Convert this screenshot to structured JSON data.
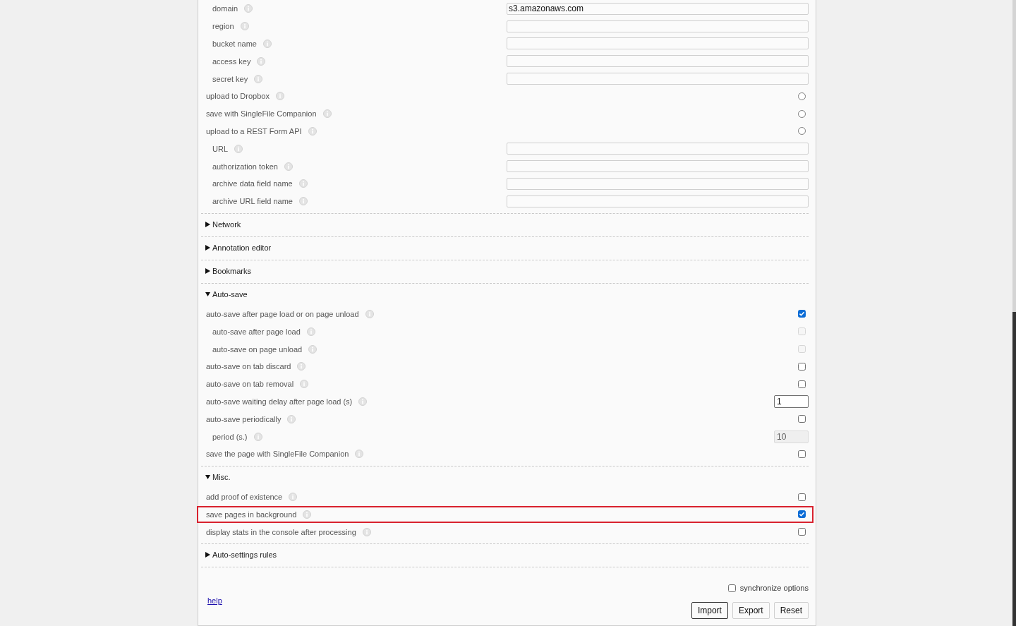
{
  "destination": {
    "sub_options": [
      {
        "label": "domain",
        "kind": "text",
        "value": "s3.amazonaws.com",
        "disabled": false
      },
      {
        "label": "region",
        "kind": "text",
        "disabled": false
      },
      {
        "label": "bucket name",
        "kind": "text",
        "disabled": false
      },
      {
        "label": "access key",
        "kind": "text",
        "disabled": false
      },
      {
        "label": "secret key",
        "kind": "text",
        "disabled": false
      }
    ],
    "options": [
      {
        "label": "upload to Dropbox",
        "kind": "radio",
        "selected": false,
        "disabled": false
      },
      {
        "label": "save with SingleFile Companion",
        "kind": "radio",
        "selected": false,
        "disabled": false
      },
      {
        "label": "upload to a REST Form API",
        "kind": "radio",
        "selected": false,
        "disabled": false,
        "children": [
          {
            "label": "URL",
            "kind": "text",
            "disabled": false
          },
          {
            "label": "authorization token",
            "kind": "text",
            "disabled": false
          },
          {
            "label": "archive data field name",
            "kind": "text",
            "disabled": false
          },
          {
            "label": "archive URL field name",
            "kind": "text",
            "disabled": false
          }
        ]
      }
    ]
  },
  "sections": [
    {
      "title": "Network",
      "expanded": false
    },
    {
      "title": "Annotation editor",
      "expanded": false
    },
    {
      "title": "Bookmarks",
      "expanded": false
    },
    {
      "title": "Auto-save",
      "expanded": true,
      "options": [
        {
          "label": "auto-save after page load or on page unload",
          "kind": "checkbox",
          "checked": true,
          "disabled": false,
          "children": [
            {
              "label": "auto-save after page load",
              "kind": "checkbox",
              "checked": false,
              "disabled": true
            },
            {
              "label": "auto-save on page unload",
              "kind": "checkbox",
              "checked": false,
              "disabled": true
            }
          ]
        },
        {
          "label": "auto-save on tab discard",
          "kind": "checkbox",
          "checked": false,
          "disabled": false
        },
        {
          "label": "auto-save on tab removal",
          "kind": "checkbox",
          "checked": false,
          "disabled": false
        },
        {
          "label": "auto-save waiting delay after page load (s)",
          "kind": "number",
          "value": "1",
          "disabled": false
        },
        {
          "label": "auto-save periodically",
          "kind": "checkbox",
          "checked": false,
          "disabled": false,
          "children": [
            {
              "label": "period (s.)",
              "kind": "number",
              "value": "10",
              "disabled": true
            }
          ]
        },
        {
          "label": "save the page with SingleFile Companion",
          "kind": "checkbox",
          "checked": false,
          "disabled": false
        }
      ]
    },
    {
      "title": "Misc.",
      "expanded": true,
      "options": [
        {
          "label": "add proof of existence",
          "kind": "checkbox",
          "checked": false,
          "disabled": false,
          "highlighted": false
        },
        {
          "label": "save pages in background",
          "kind": "checkbox",
          "checked": true,
          "disabled": false,
          "highlighted": true
        },
        {
          "label": "display stats in the console after processing",
          "kind": "checkbox",
          "checked": false,
          "disabled": false,
          "highlighted": false
        }
      ]
    },
    {
      "title": "Auto-settings rules",
      "expanded": false
    }
  ],
  "footer": {
    "synchronize": {
      "label": "synchronize options",
      "checked": false
    },
    "help_link": "help",
    "buttons": [
      {
        "label": "Import",
        "focused": true
      },
      {
        "label": "Export",
        "focused": false
      },
      {
        "label": "Reset",
        "focused": false
      }
    ]
  }
}
